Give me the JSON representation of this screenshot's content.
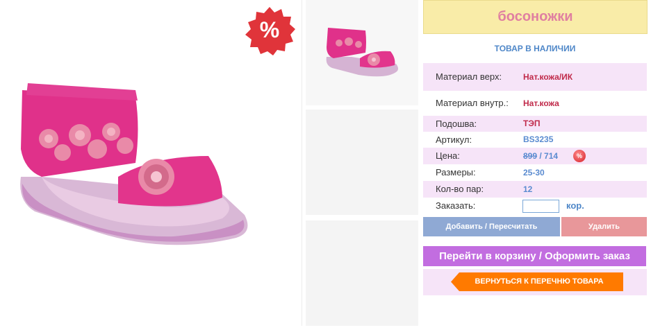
{
  "product": {
    "title": "босоножки",
    "stock_status": "ТОВАР В НАЛИЧИИ",
    "sale_badge": "%"
  },
  "details": [
    {
      "label": "Материал верх:",
      "value": "Нат.кожа/ИК"
    },
    {
      "label": "Материал внутр.:",
      "value": "Нат.кожа"
    },
    {
      "label": "Подошва:",
      "value": "ТЭП"
    },
    {
      "label": "Артикул:",
      "value": "BS3235"
    },
    {
      "label": "Размеры:",
      "value": "25-30"
    },
    {
      "label": "Кол-во пар:",
      "value": "12"
    }
  ],
  "price": {
    "label": "Цена:",
    "old": "899",
    "separator": " / ",
    "new": "714",
    "badge": "%"
  },
  "order": {
    "label": "Заказать:",
    "quantity_value": "",
    "unit": "кор."
  },
  "buttons": {
    "add": "Добавить / Пересчитать",
    "delete": "Удалить",
    "cart": "Перейти в корзину / Оформить заказ",
    "back": "ВЕРНУТЬСЯ К ПЕРЕЧНЮ ТОВАРА"
  },
  "colors": {
    "title_bg": "#f9eca8",
    "title_text": "#e07fa1",
    "row_highlight": "#f6e4f8",
    "cart_button": "#c26de0",
    "back_button": "#ff7a00",
    "add_button": "#8fa9d4",
    "delete_button": "#e8979a"
  }
}
